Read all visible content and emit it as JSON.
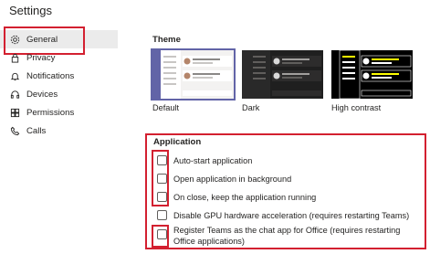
{
  "title": "Settings",
  "sidebar": {
    "items": [
      {
        "label": "General",
        "icon": "gear-icon"
      },
      {
        "label": "Privacy",
        "icon": "lock-icon"
      },
      {
        "label": "Notifications",
        "icon": "bell-icon"
      },
      {
        "label": "Devices",
        "icon": "headset-icon"
      },
      {
        "label": "Permissions",
        "icon": "shield-icon"
      },
      {
        "label": "Calls",
        "icon": "phone-icon"
      }
    ]
  },
  "theme": {
    "label": "Theme",
    "options": [
      {
        "caption": "Default",
        "selected": true
      },
      {
        "caption": "Dark",
        "selected": false
      },
      {
        "caption": "High contrast",
        "selected": false
      }
    ]
  },
  "application": {
    "label": "Application",
    "options": [
      {
        "label": "Auto-start application",
        "checked": false
      },
      {
        "label": "Open application in background",
        "checked": false
      },
      {
        "label": "On close, keep the application running",
        "checked": false
      },
      {
        "label": "Disable GPU hardware acceleration (requires restarting Teams)",
        "checked": false
      },
      {
        "label": "Register Teams as the chat app for Office (requires restarting Office applications)",
        "checked": false
      }
    ]
  },
  "colors": {
    "highlight": "#d32030",
    "accent": "#6264a7"
  }
}
